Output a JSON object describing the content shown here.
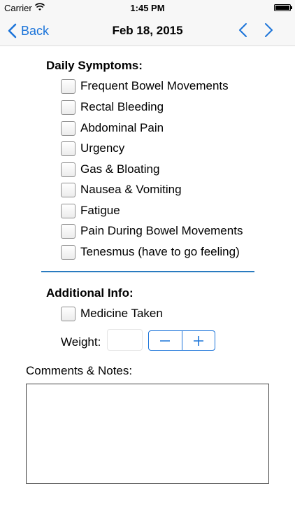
{
  "status_bar": {
    "carrier": "Carrier",
    "time": "1:45 PM"
  },
  "nav": {
    "back_label": "Back",
    "title": "Feb 18, 2015"
  },
  "daily_symptoms": {
    "title": "Daily Symptoms:",
    "items": [
      {
        "label": "Frequent Bowel Movements",
        "checked": false
      },
      {
        "label": "Rectal Bleeding",
        "checked": false
      },
      {
        "label": "Abdominal Pain",
        "checked": false
      },
      {
        "label": "Urgency",
        "checked": false
      },
      {
        "label": "Gas & Bloating",
        "checked": false
      },
      {
        "label": "Nausea & Vomiting",
        "checked": false
      },
      {
        "label": "Fatigue",
        "checked": false
      },
      {
        "label": "Pain During Bowel Movements",
        "checked": false
      },
      {
        "label": "Tenesmus (have to go feeling)",
        "checked": false
      }
    ]
  },
  "additional_info": {
    "title": "Additional Info:",
    "medicine": {
      "label": "Medicine Taken",
      "checked": false
    },
    "weight": {
      "label": "Weight:",
      "value": ""
    }
  },
  "comments": {
    "label": "Comments & Notes:",
    "value": ""
  },
  "colors": {
    "accent": "#1a73d9",
    "divider": "#2a7bc0"
  }
}
